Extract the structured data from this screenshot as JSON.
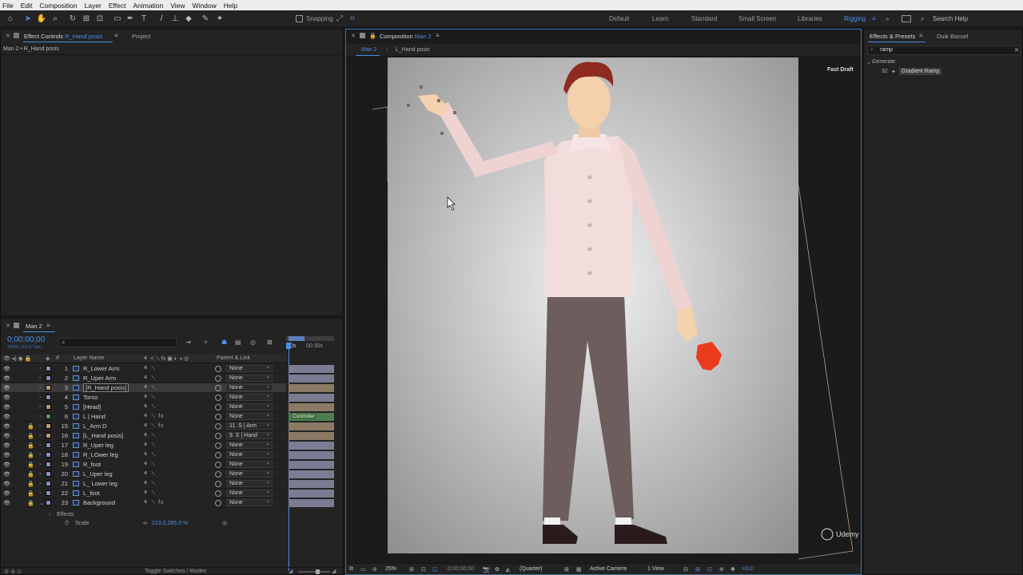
{
  "menu": [
    "File",
    "Edit",
    "Composition",
    "Layer",
    "Effect",
    "Animation",
    "View",
    "Window",
    "Help"
  ],
  "toolbar": {
    "snapping": "Snapping",
    "workspaces": [
      "Default",
      "Learn",
      "Standard",
      "Small Screen",
      "Libraries",
      "Rigging"
    ],
    "active_workspace": "Rigging",
    "search_help": "Search Help"
  },
  "effect_controls": {
    "tab_prefix": "Effect Controls",
    "tab_layer": "R_Hand posis",
    "project_tab": "Project",
    "breadcrumb": "Man 2 • R_Hand posis"
  },
  "composition": {
    "tab_prefix": "Composition",
    "tab_name": "Man 2",
    "nav": [
      "Man 2",
      "L_Hand posis"
    ],
    "fast_draft": "Fast Draft",
    "bottom": {
      "zoom": "25%",
      "timecode": "0;00;00;00",
      "resolution": "(Quarter)",
      "camera": "Active Camera",
      "views": "1 View",
      "exposure": "+0.0"
    }
  },
  "effects_presets": {
    "tab": "Effects & Presets",
    "other_tab": "Duik Bassel",
    "search_value": "ramp",
    "category": "Generate",
    "item": "Gradient Ramp"
  },
  "timeline": {
    "tab": "Man 2",
    "timecode": "0;00;00;00",
    "fps": "00000 (29.97 fps)",
    "ruler": [
      "0s",
      "00:30s"
    ],
    "col_layer_name": "Layer Name",
    "col_parent": "Parent & Link",
    "toggle_label": "Toggle Switches / Modes",
    "layers": [
      {
        "num": "1",
        "name": "R_Lower Arm",
        "color": "#8d8db8",
        "parent": "None",
        "fx": false,
        "bar": "gray"
      },
      {
        "num": "2",
        "name": "R_Uper Arm",
        "color": "#8d8db8",
        "parent": "None",
        "fx": false,
        "bar": "gray"
      },
      {
        "num": "3",
        "name": "[R_Hand posis]",
        "color": "#b79a7c",
        "parent": "None",
        "fx": false,
        "bar": "tan",
        "selected": true
      },
      {
        "num": "4",
        "name": "Torso",
        "color": "#8d8db8",
        "parent": "None",
        "fx": false,
        "bar": "gray"
      },
      {
        "num": "5",
        "name": "[Head]",
        "color": "#b79a7c",
        "parent": "None",
        "fx": false,
        "bar": "tan"
      },
      {
        "num": "6",
        "name": "L | Hand",
        "color": "#5c9a5c",
        "parent": "None",
        "fx": true,
        "bar": "green",
        "bar_label": "Controller"
      },
      {
        "num": "15",
        "name": "L_Arm D",
        "color": "#b79a7c",
        "parent": "11. S | Arm",
        "fx": true,
        "bar": "tan"
      },
      {
        "num": "16",
        "name": "[L_Hand posis]",
        "color": "#b79a7c",
        "parent": "9. S | Hand",
        "fx": false,
        "bar": "tan"
      },
      {
        "num": "17",
        "name": "R_Uper leg",
        "color": "#8d8db8",
        "parent": "None",
        "fx": false,
        "bar": "gray"
      },
      {
        "num": "18",
        "name": "R_LOwer leg",
        "color": "#8d8db8",
        "parent": "None",
        "fx": false,
        "bar": "gray"
      },
      {
        "num": "19",
        "name": "R_foot",
        "color": "#8d8db8",
        "parent": "None",
        "fx": false,
        "bar": "gray"
      },
      {
        "num": "20",
        "name": "L_Uper leg",
        "color": "#8d8db8",
        "parent": "None",
        "fx": false,
        "bar": "gray"
      },
      {
        "num": "21",
        "name": "L_ Lower leg",
        "color": "#8d8db8",
        "parent": "None",
        "fx": false,
        "bar": "gray"
      },
      {
        "num": "22",
        "name": "L_foot",
        "color": "#8d8db8",
        "parent": "None",
        "fx": false,
        "bar": "gray"
      },
      {
        "num": "23",
        "name": "Background",
        "color": "#8d8db8",
        "parent": "None",
        "fx": true,
        "bar": "gray"
      }
    ],
    "effects_label": "Effects",
    "scale_label": "Scale",
    "scale_value": "213.0,285.0 %"
  },
  "watermark": "Udemy"
}
